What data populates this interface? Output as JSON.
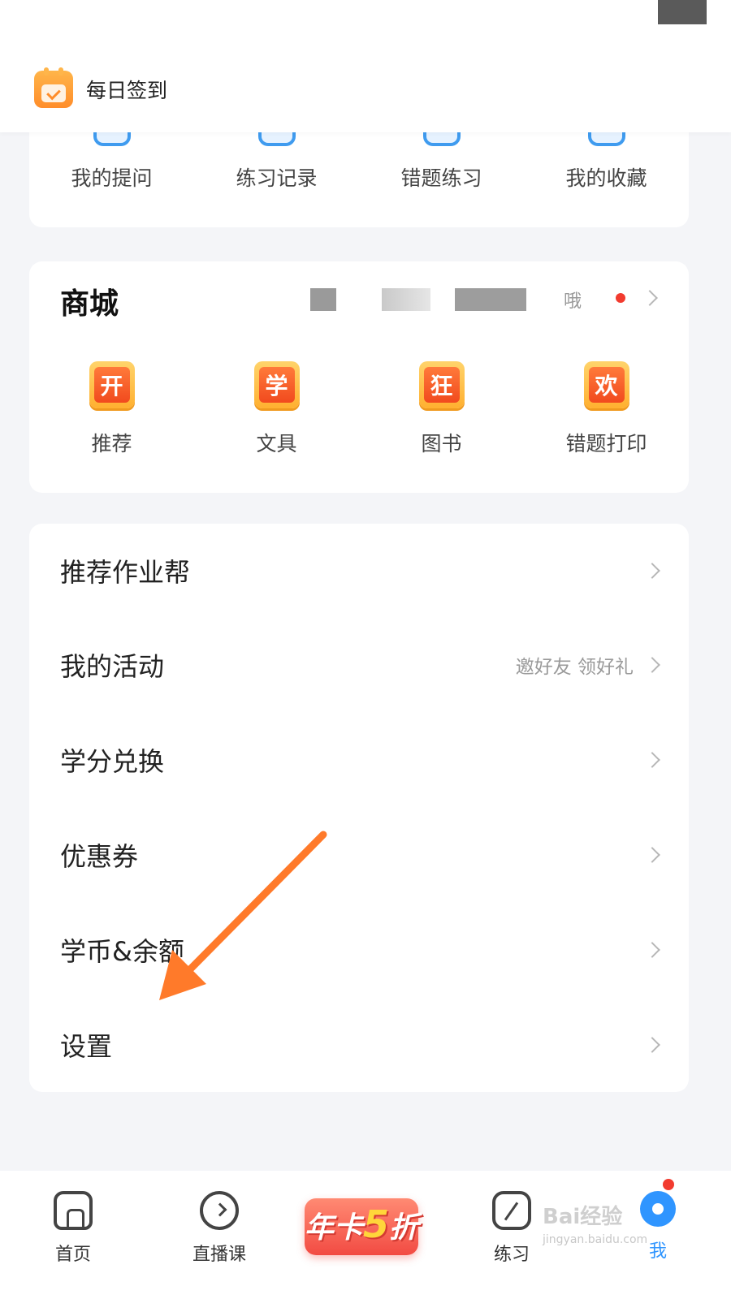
{
  "header": {
    "checkin_label": "每日签到"
  },
  "shortcuts": [
    {
      "label": "我的提问",
      "icon": "question-icon"
    },
    {
      "label": "练习记录",
      "icon": "record-icon"
    },
    {
      "label": "错题练习",
      "icon": "mistake-icon"
    },
    {
      "label": "我的收藏",
      "icon": "favorite-icon"
    }
  ],
  "mall": {
    "title": "商城",
    "more_label": "哦",
    "items": [
      {
        "label": "推荐",
        "badge": "开"
      },
      {
        "label": "文具",
        "badge": "学"
      },
      {
        "label": "图书",
        "badge": "狂"
      },
      {
        "label": "错题打印",
        "badge": "欢"
      }
    ]
  },
  "menu": [
    {
      "label": "推荐作业帮",
      "sub": ""
    },
    {
      "label": "我的活动",
      "sub": "邀好友 领好礼"
    },
    {
      "label": "学分兑换",
      "sub": ""
    },
    {
      "label": "优惠券",
      "sub": ""
    },
    {
      "label": "学币&余额",
      "sub": ""
    },
    {
      "label": "设置",
      "sub": ""
    }
  ],
  "bottom_nav": {
    "home": "首页",
    "live": "直播课",
    "promo_prefix": "年卡",
    "promo_number": "5",
    "promo_suffix": "折",
    "practice": "练习",
    "me": "我"
  },
  "watermark": {
    "brand": "Bai经验",
    "url": "jingyan.baidu.com"
  },
  "colors": {
    "accent_blue": "#2f95ff",
    "annotation_arrow": "#ff7a2a",
    "badge_red": "#f23b2f",
    "background": "#f4f5f8"
  }
}
